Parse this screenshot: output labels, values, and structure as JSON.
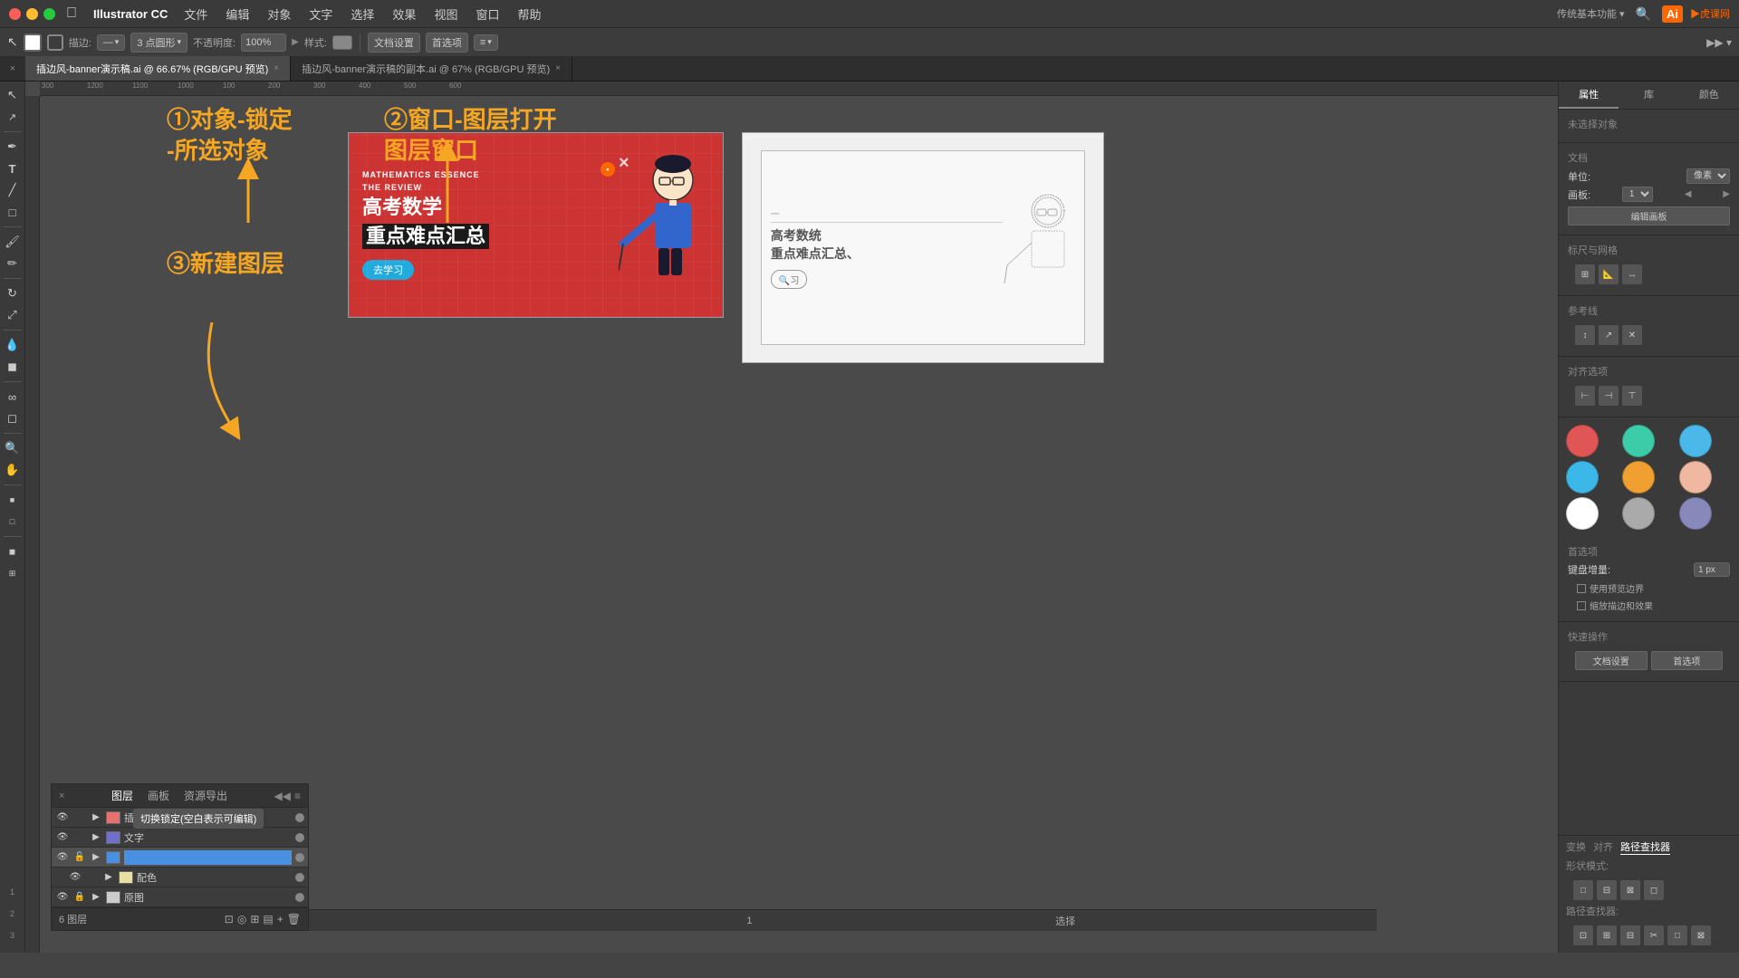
{
  "menubar": {
    "apple": "&#63743;",
    "appName": "Illustrator CC",
    "menus": [
      "文件",
      "编辑",
      "对象",
      "文字",
      "选择",
      "效果",
      "视图",
      "窗口",
      "帮助"
    ]
  },
  "toolbar": {
    "noSelection": "未选择对象",
    "stroke_label": "描边:",
    "shape_label": "3 点圆形",
    "opacity_label": "不透明度:",
    "opacity_value": "100%",
    "style_label": "样式:",
    "doc_settings": "文档设置",
    "preferences": "首选项"
  },
  "tabs": [
    {
      "label": "插边风-banner演示稿.ai @ 66.67% (RGB/GPU 预览)",
      "active": true
    },
    {
      "label": "插边风-banner演示稿的副本.ai @ 67% (RGB/GPU 预览)",
      "active": false
    }
  ],
  "annotations": {
    "step1": "①对象-锁定\n-所选对象",
    "step2": "②窗口-图层打开\n图层窗口",
    "step3": "③新建图层"
  },
  "layers_panel": {
    "title": "图层",
    "tabs": [
      "图层",
      "画板",
      "资源导出"
    ],
    "layers": [
      {
        "name": "插画",
        "visible": true,
        "locked": false,
        "expanded": false
      },
      {
        "name": "文字",
        "visible": true,
        "locked": false,
        "expanded": false
      },
      {
        "name": "",
        "visible": true,
        "locked": false,
        "expanded": false,
        "editing": true
      },
      {
        "name": "配色",
        "visible": true,
        "locked": false,
        "expanded": true,
        "sub": true
      },
      {
        "name": "原图",
        "visible": true,
        "locked": true,
        "expanded": false
      }
    ],
    "footer": "6 图层",
    "tooltip": "切换锁定(空白表示可编辑)"
  },
  "right_panel": {
    "tabs": [
      "属性",
      "库",
      "颜色"
    ],
    "no_selection": "未选择对象",
    "doc_section": "文档",
    "unit_label": "单位:",
    "unit_value": "像素",
    "artboard_label": "画板:",
    "artboard_value": "1",
    "edit_artboard_btn": "编辑画板",
    "alignment_label": "标尺与网格",
    "guides_label": "参考线",
    "align_to_label": "对齐选项",
    "preferences_section": "首选项",
    "key_increment_label": "键盘增量:",
    "key_increment_value": "1 px",
    "snap_checkbox": "使用预览边界",
    "corner_checkbox": "缩放描边和效果",
    "quick_actions": "快速操作",
    "doc_settings_btn": "文档设置",
    "preferences_btn": "首选项"
  },
  "swatches": [
    {
      "color": "#e05555",
      "name": "red"
    },
    {
      "color": "#3dcca8",
      "name": "teal"
    },
    {
      "color": "#4ab8e8",
      "name": "light-blue"
    },
    {
      "color": "#3bb8e8",
      "name": "cyan"
    },
    {
      "color": "#f0a030",
      "name": "orange"
    },
    {
      "color": "#f0b8a0",
      "name": "peach"
    },
    {
      "color": "#ffffff",
      "name": "white"
    },
    {
      "color": "#aaaaaa",
      "name": "gray"
    },
    {
      "color": "#8888bb",
      "name": "purple-gray"
    }
  ],
  "status_bar": {
    "zoom": "66.67%",
    "artboard": "1",
    "tool": "选择"
  },
  "canvas": {
    "ruler_marks": [
      "300",
      "1200",
      "1100",
      "1000",
      "100",
      "200",
      "300",
      "400",
      "500",
      "600"
    ]
  },
  "path_finder": "路径查找器",
  "shape_modes": "形状模式:",
  "path_finders_label": "路径查找器:"
}
